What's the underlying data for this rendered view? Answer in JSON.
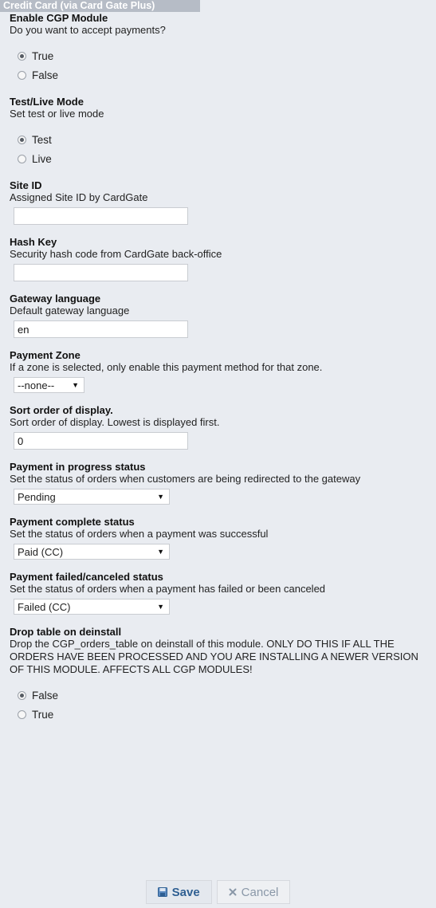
{
  "header": {
    "title": "Credit Card (via Card Gate Plus)"
  },
  "sections": {
    "enable": {
      "title": "Enable CGP Module",
      "desc": "Do you want to accept payments?",
      "options": [
        "True",
        "False"
      ],
      "selected": "True"
    },
    "mode": {
      "title": "Test/Live Mode",
      "desc": "Set test or live mode",
      "options": [
        "Test",
        "Live"
      ],
      "selected": "Test"
    },
    "site_id": {
      "title": "Site ID",
      "desc": "Assigned Site ID by CardGate",
      "value": ""
    },
    "hash_key": {
      "title": "Hash Key",
      "desc": "Security hash code from CardGate back-office",
      "value": ""
    },
    "language": {
      "title": "Gateway language",
      "desc": "Default gateway language",
      "value": "en"
    },
    "zone": {
      "title": "Payment Zone",
      "desc": "If a zone is selected, only enable this payment method for that zone.",
      "selected": "--none--"
    },
    "sort_order": {
      "title": "Sort order of display.",
      "desc": "Sort order of display. Lowest is displayed first.",
      "value": "0"
    },
    "progress_status": {
      "title": "Payment in progress status",
      "desc": "Set the status of orders when customers are being redirected to the gateway",
      "selected": "Pending"
    },
    "complete_status": {
      "title": "Payment complete status",
      "desc": "Set the status of orders when a payment was successful",
      "selected": "Paid (CC)"
    },
    "failed_status": {
      "title": "Payment failed/canceled status",
      "desc": "Set the status of orders when a payment has failed or been canceled",
      "selected": "Failed (CC)"
    },
    "drop_table": {
      "title": "Drop table on deinstall",
      "desc": "Drop the CGP_orders_table on deinstall of this module. ONLY DO THIS IF ALL THE ORDERS HAVE BEEN PROCESSED AND YOU ARE INSTALLING A NEWER VERSION OF THIS MODULE. AFFECTS ALL CGP MODULES!",
      "options": [
        "False",
        "True"
      ],
      "selected": "False"
    }
  },
  "buttons": {
    "save_label": "Save",
    "save_icon": "save-icon",
    "cancel_label": "Cancel",
    "cancel_icon": "cancel-icon"
  },
  "colors": {
    "header_bg": "#b6bcc6",
    "panel_bg": "#e9ecf1",
    "save_text": "#2f5f92",
    "cancel_text": "#8a98a8"
  }
}
